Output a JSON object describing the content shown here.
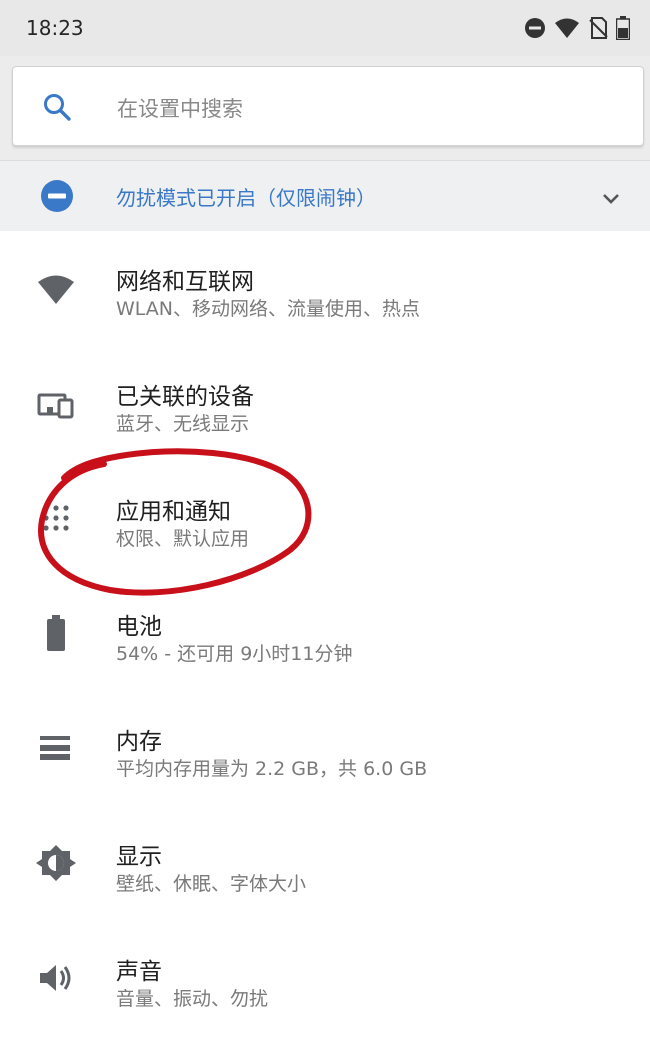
{
  "status_bar": {
    "time": "18:23",
    "icons": [
      "dnd-icon",
      "wifi-icon",
      "no-sim-icon",
      "battery-icon"
    ]
  },
  "search": {
    "placeholder": "在设置中搜索"
  },
  "dnd_banner": {
    "text": "勿扰模式已开启（仅限闹钟）"
  },
  "settings": [
    {
      "icon": "wifi-icon",
      "title": "网络和互联网",
      "subtitle": "WLAN、移动网络、流量使用、热点"
    },
    {
      "icon": "connected-devices-icon",
      "title": "已关联的设备",
      "subtitle": "蓝牙、无线显示"
    },
    {
      "icon": "apps-icon",
      "title": "应用和通知",
      "subtitle": "权限、默认应用"
    },
    {
      "icon": "battery-icon",
      "title": "电池",
      "subtitle": "54% - 还可用 9小时11分钟"
    },
    {
      "icon": "storage-icon",
      "title": "内存",
      "subtitle": "平均内存用量为 2.2 GB，共 6.0 GB"
    },
    {
      "icon": "brightness-icon",
      "title": "显示",
      "subtitle": "壁纸、休眠、字体大小"
    },
    {
      "icon": "volume-icon",
      "title": "声音",
      "subtitle": "音量、振动、勿扰"
    }
  ],
  "colors": {
    "accent": "#3a78c8",
    "annotation_red": "#c8101a",
    "icon_gray": "#5f6368"
  }
}
